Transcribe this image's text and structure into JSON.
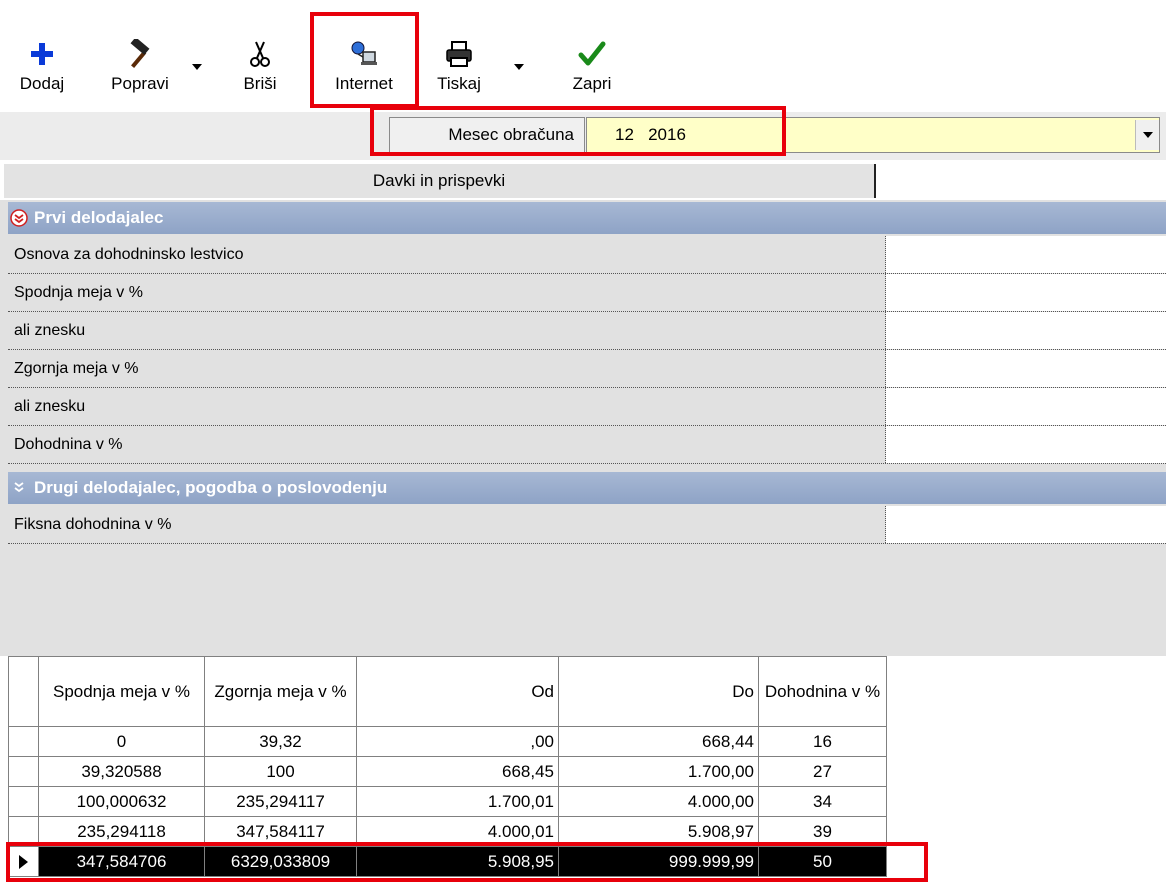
{
  "toolbar": {
    "add_label": "Dodaj",
    "edit_label": "Popravi",
    "delete_label": "Briši",
    "internet_label": "Internet",
    "print_label": "Tiskaj",
    "close_label": "Zapri"
  },
  "month": {
    "label": "Mesec obračuna",
    "value": "12   2016"
  },
  "tab": {
    "label": "Davki in prispevki"
  },
  "sections": {
    "first": {
      "title": "Prvi delodajalec",
      "rows": [
        "Osnova za dohodninsko lestvico",
        "Spodnja meja v %",
        "ali znesku",
        "Zgornja meja v %",
        "ali znesku",
        "Dohodnina v %"
      ]
    },
    "second": {
      "title": "Drugi delodajalec, pogodba o poslovodenju",
      "rows": [
        "Fiksna dohodnina v %"
      ]
    }
  },
  "table": {
    "headers": [
      "Spodnja meja v %",
      "Zgornja meja v %",
      "Od",
      "Do",
      "Dohodnina v %"
    ],
    "rows": [
      [
        "0",
        "39,32",
        ",00",
        "668,44",
        "16"
      ],
      [
        "39,320588",
        "100",
        "668,45",
        "1.700,00",
        "27"
      ],
      [
        "100,000632",
        "235,294117",
        "1.700,01",
        "4.000,00",
        "34"
      ],
      [
        "235,294118",
        "347,584117",
        "4.000,01",
        "5.908,97",
        "39"
      ],
      [
        "347,584706",
        "6329,033809",
        "5.908,95",
        "999.999,99",
        "50"
      ]
    ]
  },
  "colors": {
    "highlight_red": "#e8000b",
    "section_blue": "#8ea3c6",
    "month_value_bg": "#ffffc8",
    "add_icon_blue": "#0a3ad8",
    "check_green": "#1a8a1a"
  },
  "icons": {
    "add": "plus-icon",
    "edit": "hammer-icon",
    "delete": "scissors-icon",
    "internet": "network-icon",
    "print": "printer-icon",
    "close": "checkmark-icon"
  }
}
